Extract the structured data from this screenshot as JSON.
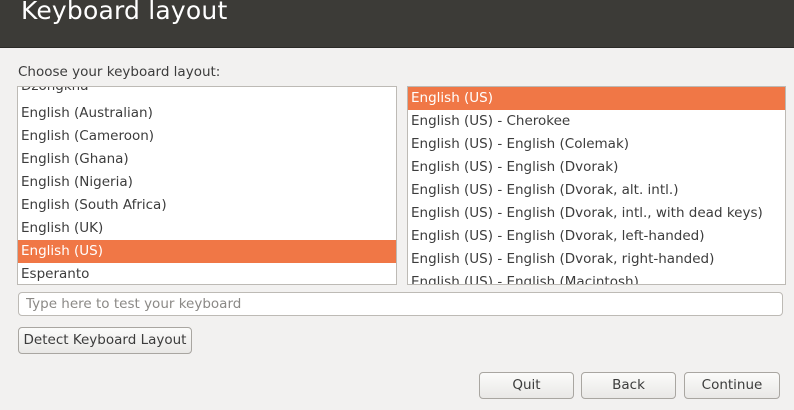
{
  "window": {
    "title": "Keyboard layout"
  },
  "prompt": "Choose your keyboard layout:",
  "layouts": {
    "items": [
      {
        "label": "Dzongkha",
        "selected": false
      },
      {
        "label": "English (Australian)",
        "selected": false
      },
      {
        "label": "English (Cameroon)",
        "selected": false
      },
      {
        "label": "English (Ghana)",
        "selected": false
      },
      {
        "label": "English (Nigeria)",
        "selected": false
      },
      {
        "label": "English (South Africa)",
        "selected": false
      },
      {
        "label": "English (UK)",
        "selected": false
      },
      {
        "label": "English (US)",
        "selected": true
      },
      {
        "label": "Esperanto",
        "selected": false
      }
    ]
  },
  "variants": {
    "items": [
      {
        "label": "English (US)",
        "selected": true
      },
      {
        "label": "English (US) - Cherokee",
        "selected": false
      },
      {
        "label": "English (US) - English (Colemak)",
        "selected": false
      },
      {
        "label": "English (US) - English (Dvorak)",
        "selected": false
      },
      {
        "label": "English (US) - English (Dvorak, alt. intl.)",
        "selected": false
      },
      {
        "label": "English (US) - English (Dvorak, intl., with dead keys)",
        "selected": false
      },
      {
        "label": "English (US) - English (Dvorak, left-handed)",
        "selected": false
      },
      {
        "label": "English (US) - English (Dvorak, right-handed)",
        "selected": false
      },
      {
        "label": "English (US) - English (Macintosh)",
        "selected": false
      }
    ]
  },
  "test_input": {
    "placeholder": "Type here to test your keyboard",
    "value": ""
  },
  "buttons": {
    "detect": "Detect Keyboard Layout",
    "quit": "Quit",
    "back": "Back",
    "continue": "Continue"
  },
  "colors": {
    "selection": "#f07746",
    "titlebar": "#3c3b37",
    "background": "#f2f1f0"
  }
}
